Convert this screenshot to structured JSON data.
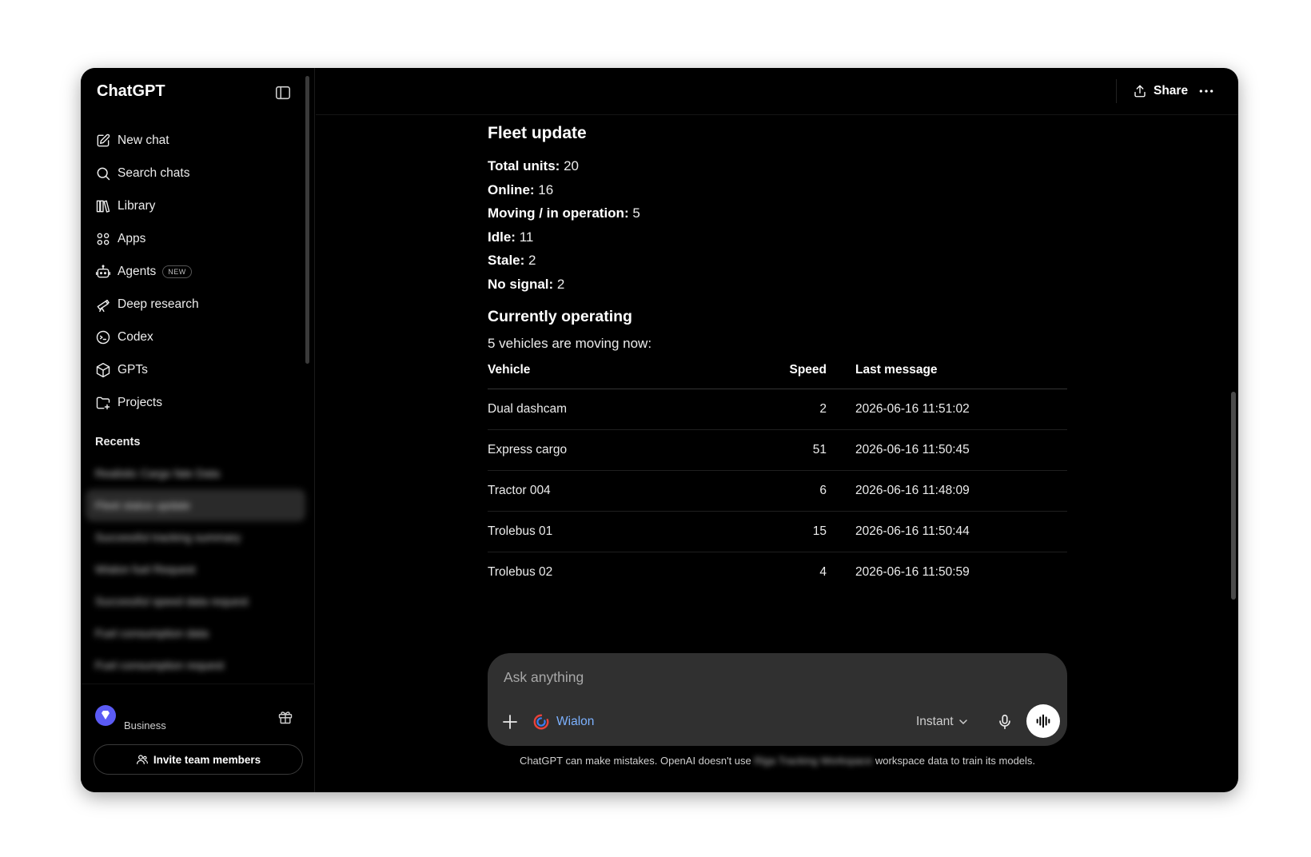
{
  "sidebar": {
    "brand": "ChatGPT",
    "nav": [
      {
        "label": "New chat",
        "icon": "edit-icon"
      },
      {
        "label": "Search chats",
        "icon": "search-icon"
      },
      {
        "label": "Library",
        "icon": "library-icon"
      },
      {
        "label": "Apps",
        "icon": "apps-icon"
      },
      {
        "label": "Agents",
        "icon": "robot-icon",
        "badge": "NEW"
      },
      {
        "label": "Deep research",
        "icon": "telescope-icon"
      },
      {
        "label": "Codex",
        "icon": "codex-icon"
      },
      {
        "label": "GPTs",
        "icon": "cube-icon"
      },
      {
        "label": "Projects",
        "icon": "folder-plus-icon"
      }
    ],
    "recents_title": "Recents",
    "recents": [
      "Realistic Cargo fate Data",
      "Fleet status update",
      "Successful tracking summary",
      "Wialon fuel Request",
      "Successful speed data request",
      "Fuel consumption data",
      "Fuel consumption request"
    ],
    "plan_label": "Business",
    "invite_label": "Invite team members"
  },
  "header": {
    "share_label": "Share"
  },
  "message": {
    "title": "Fleet update",
    "stats": [
      {
        "label": "Total units:",
        "value": "20"
      },
      {
        "label": "Online:",
        "value": "16"
      },
      {
        "label": "Moving / in operation:",
        "value": "5"
      },
      {
        "label": "Idle:",
        "value": "11"
      },
      {
        "label": "Stale:",
        "value": "2"
      },
      {
        "label": "No signal:",
        "value": "2"
      }
    ],
    "section_title": "Currently operating",
    "intro": "5 vehicles are moving now:",
    "table": {
      "headers": [
        "Vehicle",
        "Speed",
        "Last message"
      ],
      "rows": [
        [
          "Dual dashcam",
          "2",
          "2026-06-16 11:51:02"
        ],
        [
          "Express cargo",
          "51",
          "2026-06-16 11:50:45"
        ],
        [
          "Tractor 004",
          "6",
          "2026-06-16 11:48:09"
        ],
        [
          "Trolebus 01",
          "15",
          "2026-06-16 11:50:44"
        ],
        [
          "Trolebus 02",
          "4",
          "2026-06-16 11:50:59"
        ]
      ]
    }
  },
  "composer": {
    "placeholder": "Ask anything",
    "connector_label": "Wialon",
    "model_label": "Instant"
  },
  "disclaimer": {
    "part1": "ChatGPT can make mistakes. OpenAI doesn't use",
    "workspace": "Riga Tracking Workspace",
    "part2": "workspace data to train its models."
  },
  "colors": {
    "background": "#000000",
    "composer": "#303030",
    "accent_link": "#7cb1ff",
    "plan_badge": "#5b5bf5"
  }
}
